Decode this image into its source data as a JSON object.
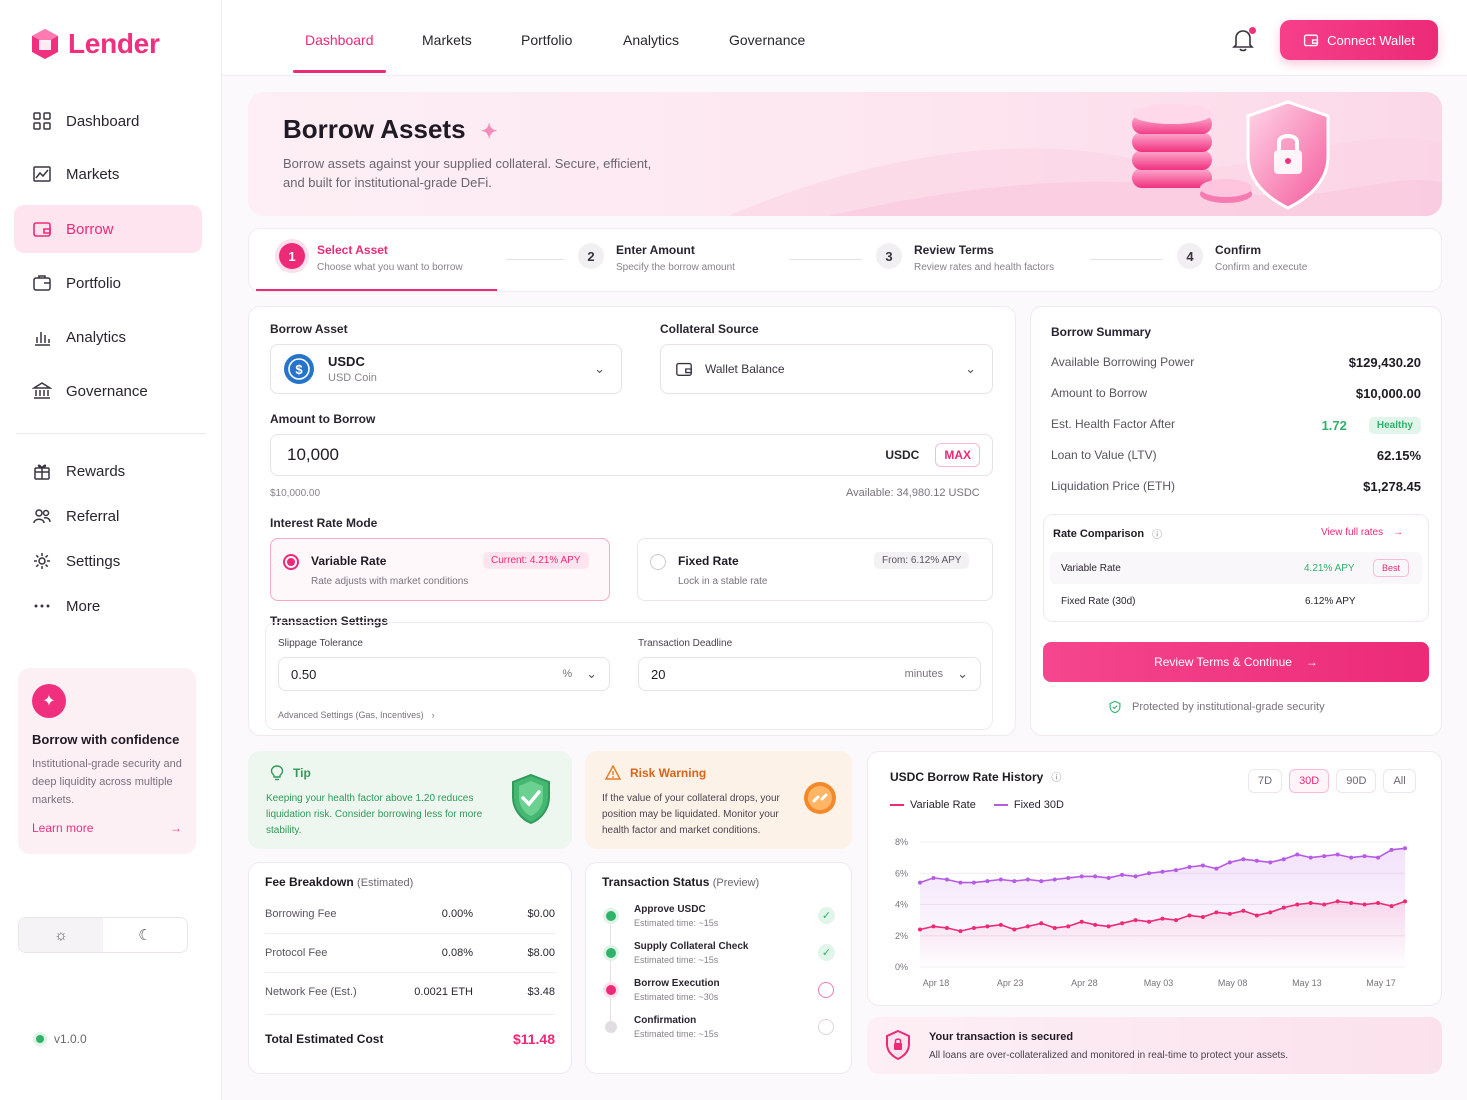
{
  "brand": {
    "name": "Lender"
  },
  "sidebar": {
    "primary": [
      {
        "label": "Dashboard",
        "icon": "grid-icon"
      },
      {
        "label": "Markets",
        "icon": "chart-icon"
      },
      {
        "label": "Borrow",
        "icon": "wallet-icon",
        "active": true
      },
      {
        "label": "Portfolio",
        "icon": "briefcase-icon"
      },
      {
        "label": "Analytics",
        "icon": "bar-chart-icon"
      },
      {
        "label": "Governance",
        "icon": "bank-icon"
      }
    ],
    "secondary": [
      {
        "label": "Rewards",
        "icon": "gift-icon"
      },
      {
        "label": "Referral",
        "icon": "users-icon"
      },
      {
        "label": "Settings",
        "icon": "gear-icon"
      },
      {
        "label": "More",
        "icon": "dots-icon"
      }
    ],
    "promo": {
      "title": "Borrow with confidence",
      "text": "Institutional-grade security and deep liquidity across multiple markets.",
      "link": "Learn more"
    },
    "version": "v1.0.0"
  },
  "topnav": {
    "tabs": [
      "Dashboard",
      "Markets",
      "Portfolio",
      "Analytics",
      "Governance"
    ],
    "active_tab": "Dashboard",
    "connect_label": "Connect Wallet"
  },
  "hero": {
    "title": "Borrow Assets",
    "subtitle_line1": "Borrow assets against your supplied collateral. Secure, efficient,",
    "subtitle_line2": "and built for institutional-grade DeFi."
  },
  "steps": [
    {
      "num": "1",
      "title": "Select Asset",
      "sub": "Choose what you want to borrow",
      "active": true
    },
    {
      "num": "2",
      "title": "Enter Amount",
      "sub": "Specify the borrow amount"
    },
    {
      "num": "3",
      "title": "Review Terms",
      "sub": "Review rates and health factors"
    },
    {
      "num": "4",
      "title": "Confirm",
      "sub": "Confirm and execute"
    }
  ],
  "form": {
    "borrow_asset_label": "Borrow Asset",
    "asset_symbol": "USDC",
    "asset_name": "USD Coin",
    "collateral_label": "Collateral Source",
    "collateral_value": "Wallet Balance",
    "amount_label": "Amount to Borrow",
    "amount_value": "10,000",
    "amount_unit": "USDC",
    "max_label": "MAX",
    "amount_usd": "$10,000.00",
    "available": "Available: 34,980.12 USDC",
    "rate_mode_label": "Interest Rate Mode",
    "variable": {
      "title": "Variable Rate",
      "sub": "Rate adjusts with market conditions",
      "badge": "Current: 4.21% APY"
    },
    "fixed": {
      "title": "Fixed Rate",
      "sub": "Lock in a stable rate",
      "badge": "From: 6.12% APY"
    },
    "tx_settings_label": "Transaction Settings",
    "slippage_label": "Slippage Tolerance",
    "slippage_value": "0.50",
    "slippage_unit": "%",
    "deadline_label": "Transaction Deadline",
    "deadline_value": "20",
    "deadline_unit": "minutes",
    "advanced": "Advanced Settings (Gas, Incentives)"
  },
  "summary": {
    "title": "Borrow Summary",
    "rows": [
      {
        "label": "Available Borrowing Power",
        "value": "$129,430.20"
      },
      {
        "label": "Amount to Borrow",
        "value": "$10,000.00"
      },
      {
        "label": "Est. Health Factor After",
        "value": "1.72",
        "badge": "Healthy"
      },
      {
        "label": "Loan to Value (LTV)",
        "value": "62.15%"
      },
      {
        "label": "Liquidation Price (ETH)",
        "value": "$1,278.45"
      }
    ],
    "rate_comparison": {
      "title": "Rate Comparison",
      "link": "View full rates",
      "rows": [
        {
          "label": "Variable Rate",
          "value": "4.21% APY",
          "badge": "Best"
        },
        {
          "label": "Fixed Rate (30d)",
          "value": "6.12% APY"
        }
      ]
    },
    "cta": "Review Terms & Continue",
    "security_note": "Protected by institutional-grade security"
  },
  "tip": {
    "title": "Tip",
    "text": "Keeping your health factor above 1.20 reduces liquidation risk. Consider borrowing less for more stability."
  },
  "risk": {
    "title": "Risk Warning",
    "text": "If the value of your collateral drops, your position may be liquidated. Monitor your health factor and market conditions."
  },
  "fees": {
    "title": "Fee Breakdown",
    "title_note": "(Estimated)",
    "rows": [
      {
        "label": "Borrowing Fee",
        "rate": "0.00%",
        "amount": "$0.00"
      },
      {
        "label": "Protocol Fee",
        "rate": "0.08%",
        "amount": "$8.00"
      },
      {
        "label": "Network Fee (Est.)",
        "rate": "0.0021 ETH",
        "amount": "$3.48"
      }
    ],
    "total_label": "Total Estimated Cost",
    "total_value": "$11.48"
  },
  "tx_status": {
    "title": "Transaction Status",
    "title_note": "(Preview)",
    "items": [
      {
        "title": "Approve USDC",
        "sub": "Estimated time: ~15s",
        "state": "done"
      },
      {
        "title": "Supply Collateral Check",
        "sub": "Estimated time: ~15s",
        "state": "done"
      },
      {
        "title": "Borrow Execution",
        "sub": "Estimated time: ~30s",
        "state": "active"
      },
      {
        "title": "Confirmation",
        "sub": "Estimated time: ~15s",
        "state": "pending"
      }
    ]
  },
  "secured": {
    "title": "Your transaction is secured",
    "text": "All loans are over-collateralized and monitored in real-time to protect your assets."
  },
  "ranges": [
    "7D",
    "30D",
    "90D",
    "All"
  ],
  "active_range": "30D",
  "colors": {
    "accent": "#ec2a78",
    "variable": "#ec2a78",
    "fixed": "#b65be6",
    "success": "#2fb36b"
  },
  "chart_data": {
    "type": "line",
    "title": "USDC Borrow Rate History",
    "x_ticks": [
      "Apr 18",
      "Apr 23",
      "Apr 28",
      "May 03",
      "May 08",
      "May 13",
      "May 17"
    ],
    "y_ticks": [
      "0%",
      "2%",
      "4%",
      "6%",
      "8%"
    ],
    "ylim": [
      0,
      8
    ],
    "series": [
      {
        "name": "Variable Rate",
        "values": [
          2.4,
          2.6,
          2.5,
          2.3,
          2.5,
          2.6,
          2.7,
          2.4,
          2.6,
          2.8,
          2.5,
          2.6,
          2.9,
          2.7,
          2.6,
          2.8,
          3.0,
          2.9,
          3.1,
          3.0,
          3.3,
          3.2,
          3.5,
          3.4,
          3.6,
          3.3,
          3.5,
          3.8,
          4.0,
          4.1,
          4.0,
          4.2,
          4.1,
          4.0,
          4.1,
          3.9,
          4.2
        ]
      },
      {
        "name": "Fixed 30D",
        "values": [
          5.4,
          5.7,
          5.6,
          5.4,
          5.4,
          5.5,
          5.6,
          5.5,
          5.6,
          5.5,
          5.6,
          5.7,
          5.8,
          5.8,
          5.7,
          5.9,
          5.8,
          6.0,
          6.1,
          6.2,
          6.4,
          6.5,
          6.3,
          6.7,
          6.9,
          6.8,
          6.7,
          6.9,
          7.2,
          7.0,
          7.1,
          7.2,
          7.0,
          7.1,
          7.0,
          7.5,
          7.6
        ]
      }
    ]
  }
}
